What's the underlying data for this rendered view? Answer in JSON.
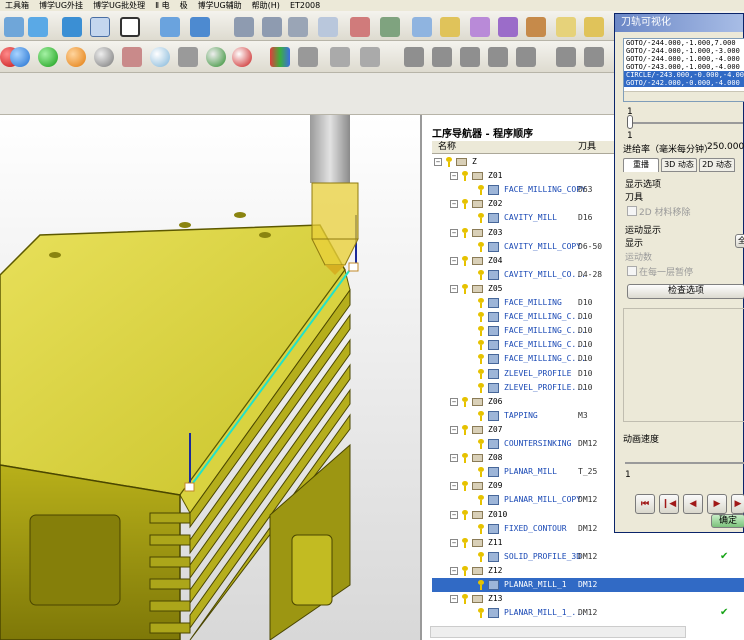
{
  "menubar": [
    "工具箱",
    "博学UG外挂",
    "博学UG批处理",
    "Ⅱ 电",
    "极",
    "博学UG辅助",
    "帮助(H)",
    "ET2008"
  ],
  "navigator": {
    "title": "工序导航器 - 程序顺序",
    "col_name": "名称",
    "col_tool": "刀具",
    "rows": [
      {
        "level": 0,
        "type": "group",
        "label": "Z",
        "tool": "",
        "check": ""
      },
      {
        "level": 1,
        "type": "group",
        "label": "Z01",
        "tool": "",
        "check": ""
      },
      {
        "level": 2,
        "type": "op",
        "label": "FACE_MILLING_COPY",
        "tool": "D63",
        "check": ""
      },
      {
        "level": 1,
        "type": "group",
        "label": "Z02",
        "tool": "",
        "check": ""
      },
      {
        "level": 2,
        "type": "op",
        "label": "CAVITY_MILL",
        "tool": "D16",
        "check": ""
      },
      {
        "level": 1,
        "type": "group",
        "label": "Z03",
        "tool": "",
        "check": ""
      },
      {
        "level": 2,
        "type": "op",
        "label": "CAVITY_MILL_COPY",
        "tool": "D6-50",
        "check": ""
      },
      {
        "level": 1,
        "type": "group",
        "label": "Z04",
        "tool": "",
        "check": ""
      },
      {
        "level": 2,
        "type": "op",
        "label": "CAVITY_MILL_CO...",
        "tool": "D4-28",
        "check": ""
      },
      {
        "level": 1,
        "type": "group",
        "label": "Z05",
        "tool": "",
        "check": ""
      },
      {
        "level": 2,
        "type": "op",
        "label": "FACE_MILLING",
        "tool": "D10",
        "check": ""
      },
      {
        "level": 2,
        "type": "op",
        "label": "FACE_MILLING_C...",
        "tool": "D10",
        "check": ""
      },
      {
        "level": 2,
        "type": "op",
        "label": "FACE_MILLING_C...",
        "tool": "D10",
        "check": ""
      },
      {
        "level": 2,
        "type": "op",
        "label": "FACE_MILLING_C...",
        "tool": "D10",
        "check": ""
      },
      {
        "level": 2,
        "type": "op",
        "label": "FACE_MILLING_C...",
        "tool": "D10",
        "check": ""
      },
      {
        "level": 2,
        "type": "op",
        "label": "ZLEVEL_PROFILE",
        "tool": "D10",
        "check": ""
      },
      {
        "level": 2,
        "type": "op",
        "label": "ZLEVEL_PROFILE...",
        "tool": "D10",
        "check": ""
      },
      {
        "level": 1,
        "type": "group",
        "label": "Z06",
        "tool": "",
        "check": ""
      },
      {
        "level": 2,
        "type": "op",
        "label": "TAPPING",
        "tool": "M3",
        "check": ""
      },
      {
        "level": 1,
        "type": "group",
        "label": "Z07",
        "tool": "",
        "check": ""
      },
      {
        "level": 2,
        "type": "op",
        "label": "COUNTERSINKING",
        "tool": "DM12",
        "check": ""
      },
      {
        "level": 1,
        "type": "group",
        "label": "Z08",
        "tool": "",
        "check": ""
      },
      {
        "level": 2,
        "type": "op",
        "label": "PLANAR_MILL",
        "tool": "T_25",
        "check": ""
      },
      {
        "level": 1,
        "type": "group",
        "label": "Z09",
        "tool": "",
        "check": ""
      },
      {
        "level": 2,
        "type": "op",
        "label": "PLANAR_MILL_COPY",
        "tool": "DM12",
        "check": ""
      },
      {
        "level": 1,
        "type": "group",
        "label": "Z010",
        "tool": "",
        "check": ""
      },
      {
        "level": 2,
        "type": "op",
        "label": "FIXED_CONTOUR",
        "tool": "DM12",
        "check": ""
      },
      {
        "level": 1,
        "type": "group",
        "label": "Z11",
        "tool": "",
        "check": ""
      },
      {
        "level": 2,
        "type": "op",
        "label": "SOLID_PROFILE_3D",
        "tool": "DM12",
        "check": "✔"
      },
      {
        "level": 1,
        "type": "group",
        "label": "Z12",
        "tool": "",
        "check": ""
      },
      {
        "level": 2,
        "type": "op",
        "label": "PLANAR_MILL_1",
        "tool": "DM12",
        "check": "",
        "selected": true
      },
      {
        "level": 1,
        "type": "group",
        "label": "Z13",
        "tool": "",
        "check": ""
      },
      {
        "level": 2,
        "type": "op",
        "label": "PLANAR_MILL_1_...",
        "tool": "DM12",
        "check": "✔"
      }
    ]
  },
  "dialog": {
    "title": "刀轨可视化",
    "list": [
      "GOTO/-244.000,-1.000,7.000",
      "GOTO/-244.000,-1.000,-3.000",
      "GOTO/-244.000,-1.000,-4.000",
      "GOTO/-243.000,-1.000,-4.000",
      "CIRCLE/-243.000,-0.000,-4.00",
      "GOTO/-242.000,-0.000,-4.000"
    ],
    "slider_min": "1",
    "slider_min2": "1",
    "feed_label": "进给率（毫米每分钟）",
    "feed_value": "250.0000",
    "tabs": [
      "重播",
      "3D 动态",
      "2D 动态"
    ],
    "display_options": "显示选项",
    "tool": "刀具",
    "remove_2d": "2D 材料移除",
    "motion_display": "运动显示",
    "display": "显示",
    "display_btn": "全",
    "motion_count": "运动数",
    "pause_each": "在每一层暂停",
    "check_options": "检查选项",
    "anim_speed": "动画速度",
    "speed_min": "1",
    "nav_buttons": [
      "⏮",
      "❙◀",
      "◀",
      "▶",
      "▶"
    ],
    "ok": "确定"
  }
}
